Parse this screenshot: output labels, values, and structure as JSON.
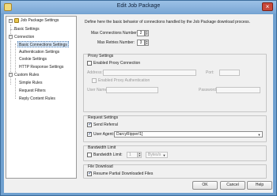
{
  "window": {
    "title": "Edit Job Package",
    "close_glyph": "×"
  },
  "tree": {
    "items": [
      {
        "label": "Job Package Settings"
      },
      {
        "label": "Basic Settings"
      },
      {
        "label": "Connection"
      },
      {
        "label": "Basic Connections Settings"
      },
      {
        "label": "Authentication Settings"
      },
      {
        "label": "Cookie Settings"
      },
      {
        "label": "HTTP Response Settings"
      },
      {
        "label": "Custom Rules"
      },
      {
        "label": "Simple Rules"
      },
      {
        "label": "Request Filters"
      },
      {
        "label": "Reply Content Rules"
      }
    ],
    "collapse_glyph": "−"
  },
  "panel": {
    "description": "Define here the basic behavior of connections handled by the Job Package download process.",
    "max_connections": {
      "label": "Max Connections Number:",
      "value": "2"
    },
    "max_retries": {
      "label": "Max Retries Number:",
      "value": "3"
    },
    "proxy": {
      "title": "Proxy Settings",
      "enable_label": "Enabled Proxy Connection",
      "address_label": "Address:",
      "port_label": "Port:",
      "auth_label": "Enabled Proxy Authentication",
      "username_label": "User Name:",
      "password_label": "Password:"
    },
    "request": {
      "title": "Request Settings",
      "send_referral_label": "Send Referral",
      "user_agent_label": "User Agent:",
      "user_agent_value": "DarcyRipper/1]"
    },
    "bandwidth": {
      "title": "Bandwidth Limit",
      "limit_label": "Bandwidth Limit:",
      "limit_value": "1",
      "unit_value": "Bytes/s"
    },
    "file_download": {
      "title": "File Download",
      "resume_label": "Resume Partial Downloaded Files"
    }
  },
  "buttons": {
    "ok": "OK",
    "cancel": "Cancel",
    "help": "Help"
  },
  "glyphs": {
    "check": "✓",
    "spin_up": "▲",
    "spin_down": "▼",
    "dropdown": "▼"
  },
  "colors": {
    "titlebar": "#79a6d4",
    "selection": "#d9e8f8",
    "close": "#c8483a"
  }
}
